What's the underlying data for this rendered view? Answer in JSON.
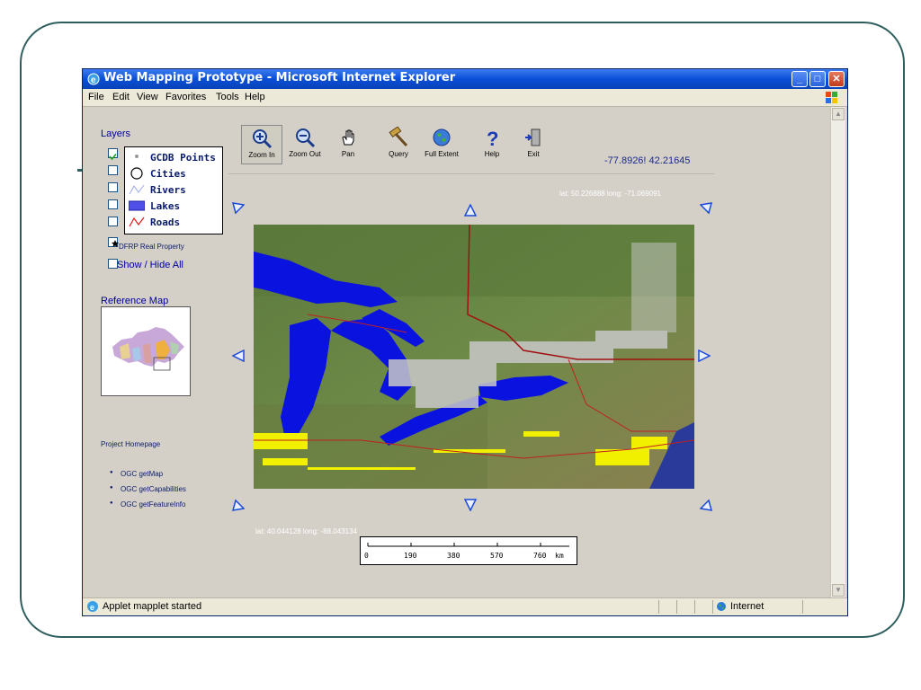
{
  "window": {
    "title": "Web Mapping Prototype - Microsoft Internet Explorer"
  },
  "menu": [
    "File",
    "Edit",
    "View",
    "Favorites",
    "Tools",
    "Help"
  ],
  "layers": {
    "title": "Layers",
    "items": [
      {
        "label": "GCDB Points",
        "checked": true
      },
      {
        "label": "Cities",
        "checked": false
      },
      {
        "label": "Rivers",
        "checked": false
      },
      {
        "label": "Lakes",
        "checked": false
      },
      {
        "label": "Roads",
        "checked": false
      }
    ],
    "dfrp_label": "DFRP Real Property",
    "show_hide_label": "Show / Hide All"
  },
  "reference_map": {
    "title": "Reference Map"
  },
  "links": {
    "project_homepage": "Project Homepage",
    "ogc": [
      "OGC getMap",
      "OGC getCapabilities",
      "OGC getFeatureInfo"
    ]
  },
  "toolbar": {
    "tools": [
      {
        "label": "Zoom In",
        "icon": "zoom-in-icon"
      },
      {
        "label": "Zoom Out",
        "icon": "zoom-out-icon"
      },
      {
        "label": "Pan",
        "icon": "hand-icon"
      },
      {
        "label": "Query",
        "icon": "hammer-icon"
      },
      {
        "label": "Full Extent",
        "icon": "globe-icon"
      },
      {
        "label": "Help",
        "icon": "question-icon"
      },
      {
        "label": "Exit",
        "icon": "exit-door-icon"
      }
    ],
    "active_tool": "Zoom In",
    "coordinates": "-77.8926! 42.21645"
  },
  "map": {
    "top_right_latlong": "lat: 50.226888 long: -71.069091",
    "bottom_left_latlong": "lat: 40.044128 long: -88.043134",
    "scale": {
      "ticks": [
        "0",
        "190",
        "380",
        "570",
        "760"
      ],
      "unit": "km"
    }
  },
  "status": {
    "text": "Applet mapplet started",
    "zone": "Internet"
  },
  "colors": {
    "titlebar": "#0a4fd6",
    "link": "#0a1b6a",
    "lake": "#0a12e0",
    "points": "#f0f000"
  }
}
